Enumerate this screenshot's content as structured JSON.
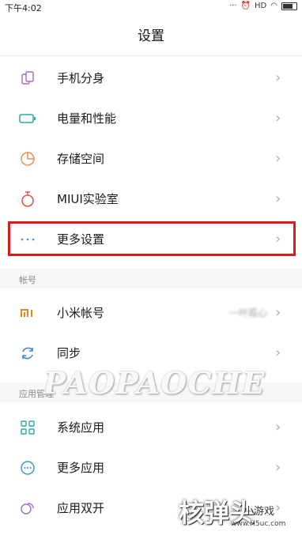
{
  "status_bar": {
    "time": "下午4:02"
  },
  "header": {
    "title": "设置"
  },
  "items": [
    {
      "label": "手机分身",
      "icon": "dual-phone-icon"
    },
    {
      "label": "电量和性能",
      "icon": "battery-icon"
    },
    {
      "label": "存储空间",
      "icon": "pie-storage-icon"
    },
    {
      "label": "MIUI实验室",
      "icon": "flask-icon"
    },
    {
      "label": "更多设置",
      "icon": "more-dots-icon"
    }
  ],
  "account_section": {
    "title": "帐号",
    "items": [
      {
        "label": "小米帐号",
        "value": "一叶孤心",
        "icon": "mi-logo-icon"
      },
      {
        "label": "同步",
        "icon": "sync-icon"
      }
    ]
  },
  "apps_section": {
    "title": "应用管理",
    "items": [
      {
        "label": "系统应用",
        "icon": "grid-apps-icon"
      },
      {
        "label": "更多应用",
        "icon": "more-apps-icon"
      },
      {
        "label": "应用双开",
        "icon": "dual-apps-icon"
      }
    ]
  },
  "watermark": "PAOPAOCHE",
  "brand": {
    "name": "核弹头",
    "sub": "小游戏",
    "url": "www.H5uc.com"
  },
  "colors": {
    "highlight": "#e0191b",
    "accent": "#2aa7a7"
  }
}
